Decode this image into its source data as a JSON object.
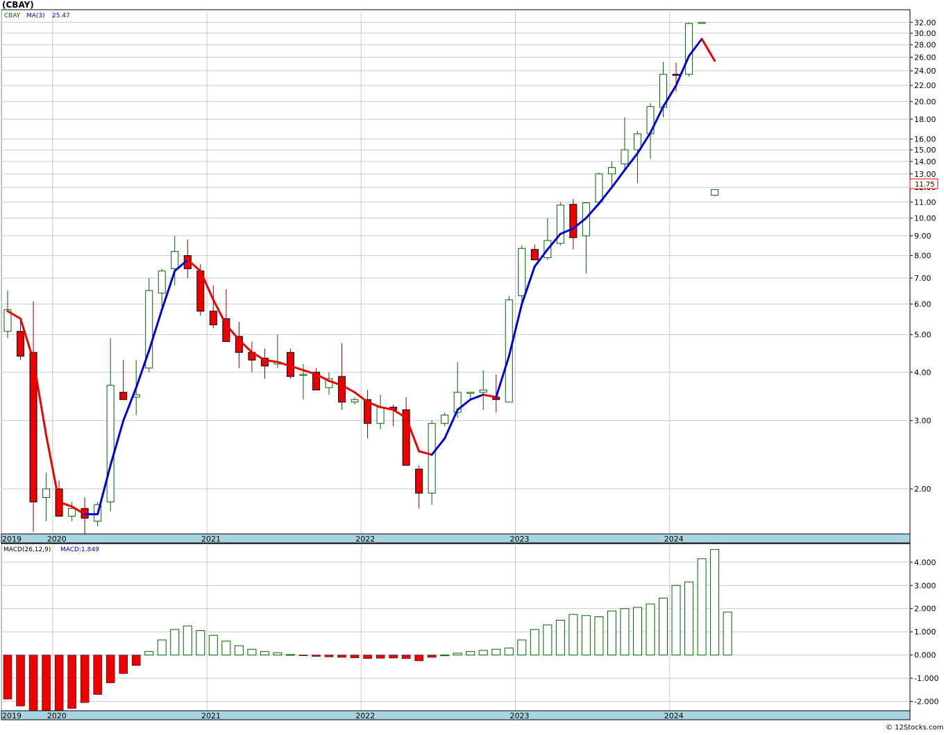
{
  "title": "(CBAY)",
  "copyright": "© 12Stocks.com",
  "colors": {
    "up_candle": "#006400",
    "down_candle": "#ee0000",
    "ma_up": "#0000dd",
    "ma_down": "#ee0000",
    "axis_band": "#a8d4e0",
    "grid": "#c8c8c8",
    "last_price_box": "#ee0000"
  },
  "price_panel": {
    "symbol_label": "CBAY",
    "ma_label": "MA(3)",
    "ma_value": "25.47",
    "last_price": "11.75"
  },
  "macd_panel": {
    "label": "MACD(26,12,9)",
    "value_label": "MACD:1.849"
  },
  "chart_data": [
    {
      "type": "candlestick",
      "scale": "log",
      "ylim": [
        1.53,
        34.5
      ],
      "yticks": [
        2.0,
        3.0,
        4.0,
        5.0,
        6.0,
        7.0,
        8.0,
        9.0,
        10.0,
        11.0,
        12.0,
        13.0,
        14.0,
        15.0,
        16.0,
        18.0,
        20.0,
        22.0,
        24.0,
        26.0,
        28.0,
        30.0,
        32.0
      ],
      "ytick_labels": [
        "2.00",
        "3.00",
        "4.00",
        "5.00",
        "6.00",
        "7.00",
        "8.00",
        "9.00",
        "10.00",
        "11.00",
        "12.00",
        "13.00",
        "14.00",
        "15.00",
        "16.00",
        "18.00",
        "20.00",
        "22.00",
        "24.00",
        "26.00",
        "28.00",
        "30.00",
        "32.00"
      ],
      "x_year_labels": [
        {
          "label": "2019",
          "index": 0
        },
        {
          "label": "2020",
          "index": 4
        },
        {
          "label": "2021",
          "index": 16
        },
        {
          "label": "2022",
          "index": 28
        },
        {
          "label": "2023",
          "index": 40
        },
        {
          "label": "2024",
          "index": 52
        }
      ],
      "candles": [
        {
          "o": 5.1,
          "h": 6.5,
          "l": 4.9,
          "c": 5.8
        },
        {
          "o": 5.1,
          "h": 5.5,
          "l": 4.3,
          "c": 4.4
        },
        {
          "o": 4.5,
          "h": 6.1,
          "l": 1.55,
          "c": 1.85
        },
        {
          "o": 1.9,
          "h": 2.2,
          "l": 1.65,
          "c": 2.0
        },
        {
          "o": 2.0,
          "h": 2.1,
          "l": 1.7,
          "c": 1.7
        },
        {
          "o": 1.7,
          "h": 1.85,
          "l": 1.65,
          "c": 1.78
        },
        {
          "o": 1.78,
          "h": 1.9,
          "l": 1.52,
          "c": 1.68
        },
        {
          "o": 1.65,
          "h": 1.85,
          "l": 1.6,
          "c": 1.82
        },
        {
          "o": 1.85,
          "h": 4.9,
          "l": 1.75,
          "c": 3.7
        },
        {
          "o": 3.55,
          "h": 4.3,
          "l": 3.4,
          "c": 3.4
        },
        {
          "o": 3.45,
          "h": 4.3,
          "l": 3.1,
          "c": 3.5
        },
        {
          "o": 4.1,
          "h": 7.0,
          "l": 4.0,
          "c": 6.5
        },
        {
          "o": 6.4,
          "h": 7.4,
          "l": 5.9,
          "c": 7.3
        },
        {
          "o": 7.4,
          "h": 9.0,
          "l": 6.7,
          "c": 8.2
        },
        {
          "o": 8.0,
          "h": 8.8,
          "l": 7.0,
          "c": 7.4
        },
        {
          "o": 7.3,
          "h": 7.6,
          "l": 5.6,
          "c": 5.75
        },
        {
          "o": 5.75,
          "h": 6.7,
          "l": 5.2,
          "c": 5.3
        },
        {
          "o": 5.5,
          "h": 6.55,
          "l": 4.8,
          "c": 4.8
        },
        {
          "o": 4.95,
          "h": 5.4,
          "l": 4.1,
          "c": 4.5
        },
        {
          "o": 4.5,
          "h": 4.8,
          "l": 4.0,
          "c": 4.3
        },
        {
          "o": 4.35,
          "h": 4.6,
          "l": 3.85,
          "c": 4.15
        },
        {
          "o": 4.2,
          "h": 5.0,
          "l": 4.1,
          "c": 4.25
        },
        {
          "o": 4.5,
          "h": 4.6,
          "l": 3.85,
          "c": 3.9
        },
        {
          "o": 3.95,
          "h": 4.2,
          "l": 3.4,
          "c": 3.95
        },
        {
          "o": 4.0,
          "h": 4.1,
          "l": 3.6,
          "c": 3.6
        },
        {
          "o": 3.65,
          "h": 4.0,
          "l": 3.5,
          "c": 3.85
        },
        {
          "o": 3.9,
          "h": 4.75,
          "l": 3.2,
          "c": 3.35
        },
        {
          "o": 3.35,
          "h": 3.45,
          "l": 3.3,
          "c": 3.4
        },
        {
          "o": 3.4,
          "h": 3.6,
          "l": 2.7,
          "c": 2.95
        },
        {
          "o": 2.95,
          "h": 3.5,
          "l": 2.85,
          "c": 3.25
        },
        {
          "o": 3.25,
          "h": 3.3,
          "l": 2.9,
          "c": 3.2
        },
        {
          "o": 3.2,
          "h": 3.45,
          "l": 2.3,
          "c": 2.3
        },
        {
          "o": 2.25,
          "h": 2.3,
          "l": 1.78,
          "c": 1.95
        },
        {
          "o": 1.95,
          "h": 3.0,
          "l": 1.82,
          "c": 2.95
        },
        {
          "o": 2.95,
          "h": 3.15,
          "l": 2.9,
          "c": 3.1
        },
        {
          "o": 3.15,
          "h": 4.25,
          "l": 3.05,
          "c": 3.55
        },
        {
          "o": 3.55,
          "h": 3.55,
          "l": 3.4,
          "c": 3.55
        },
        {
          "o": 3.55,
          "h": 4.05,
          "l": 3.2,
          "c": 3.6
        },
        {
          "o": 3.45,
          "h": 3.95,
          "l": 3.15,
          "c": 3.4
        },
        {
          "o": 3.35,
          "h": 6.3,
          "l": 3.35,
          "c": 6.15
        },
        {
          "o": 6.3,
          "h": 8.5,
          "l": 6.0,
          "c": 8.35
        },
        {
          "o": 8.3,
          "h": 8.55,
          "l": 7.8,
          "c": 7.8
        },
        {
          "o": 7.9,
          "h": 10.0,
          "l": 7.8,
          "c": 8.75
        },
        {
          "o": 8.6,
          "h": 11.0,
          "l": 8.5,
          "c": 10.8
        },
        {
          "o": 10.85,
          "h": 11.2,
          "l": 8.3,
          "c": 8.9
        },
        {
          "o": 9.0,
          "h": 11.0,
          "l": 7.2,
          "c": 10.95
        },
        {
          "o": 11.0,
          "h": 13.1,
          "l": 10.8,
          "c": 13.0
        },
        {
          "o": 13.0,
          "h": 14.0,
          "l": 12.0,
          "c": 13.5
        },
        {
          "o": 13.8,
          "h": 18.2,
          "l": 13.3,
          "c": 15.0
        },
        {
          "o": 15.0,
          "h": 16.8,
          "l": 12.3,
          "c": 16.5
        },
        {
          "o": 16.5,
          "h": 19.8,
          "l": 14.2,
          "c": 19.4
        },
        {
          "o": 19.3,
          "h": 25.3,
          "l": 18.2,
          "c": 23.5
        },
        {
          "o": 23.5,
          "h": 25.2,
          "l": 21.2,
          "c": 23.4
        },
        {
          "o": 23.5,
          "h": 32.0,
          "l": 23.2,
          "c": 31.8
        },
        {
          "o": 31.9,
          "h": 32.1,
          "l": 31.7,
          "c": 32.0
        },
        {
          "o": 11.45,
          "h": 11.85,
          "l": 11.4,
          "c": 11.85
        }
      ],
      "ma3": [
        5.75,
        5.5,
        4.3,
        2.75,
        1.85,
        1.8,
        1.72,
        1.72,
        2.3,
        3.0,
        3.65,
        4.55,
        5.8,
        7.3,
        7.8,
        7.3,
        6.15,
        5.3,
        4.85,
        4.5,
        4.3,
        4.25,
        4.15,
        4.05,
        3.95,
        3.8,
        3.7,
        3.55,
        3.35,
        3.25,
        3.2,
        3.05,
        2.5,
        2.45,
        2.7,
        3.2,
        3.4,
        3.5,
        3.45,
        4.4,
        6.0,
        7.5,
        8.3,
        9.1,
        9.4,
        10.0,
        10.9,
        12.0,
        13.3,
        14.7,
        16.6,
        19.4,
        22.0,
        26.2,
        29.0,
        25.47
      ]
    },
    {
      "type": "bar",
      "title": "MACD(26,12,9)",
      "ylim": [
        -2.4,
        4.8
      ],
      "yticks": [
        -2.0,
        -1.0,
        0.0,
        1.0,
        2.0,
        3.0,
        4.0
      ],
      "ytick_labels": [
        "-2.000",
        "-1.000",
        "0.000",
        "1.000",
        "2.000",
        "3.000",
        "4.000"
      ],
      "values": [
        -1.9,
        -2.2,
        -2.4,
        -2.4,
        -2.4,
        -2.3,
        -2.05,
        -1.7,
        -1.2,
        -0.8,
        -0.45,
        0.15,
        0.65,
        1.1,
        1.25,
        1.05,
        0.85,
        0.6,
        0.4,
        0.25,
        0.15,
        0.1,
        0.02,
        -0.03,
        -0.06,
        -0.08,
        -0.1,
        -0.12,
        -0.15,
        -0.14,
        -0.13,
        -0.15,
        -0.25,
        -0.1,
        0.0,
        0.08,
        0.15,
        0.2,
        0.25,
        0.3,
        0.65,
        1.1,
        1.3,
        1.5,
        1.75,
        1.7,
        1.65,
        1.9,
        2.0,
        2.05,
        2.2,
        2.45,
        3.0,
        3.15,
        4.15,
        4.55,
        1.849
      ]
    }
  ]
}
